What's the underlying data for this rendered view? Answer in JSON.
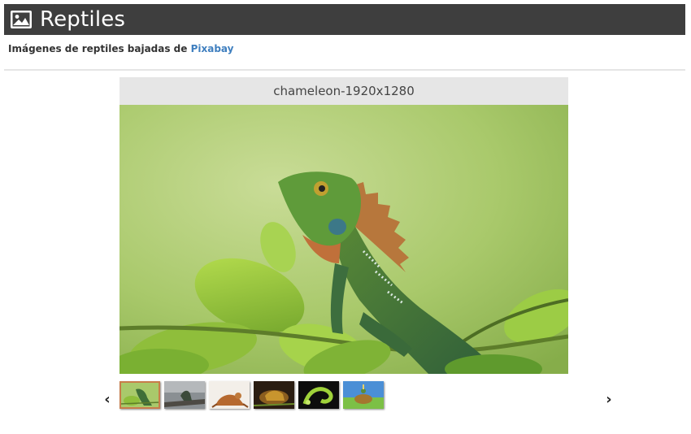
{
  "header": {
    "title": "Reptiles",
    "icon": "image-icon"
  },
  "subtitle": {
    "text": "Imágenes de reptiles bajadas de ",
    "link_label": "Pixabay"
  },
  "viewer": {
    "caption": "chameleon-1920x1280",
    "prev_label": "‹",
    "next_label": "›"
  },
  "thumbnails": [
    {
      "name": "chameleon",
      "active": true
    },
    {
      "name": "lizard-on-branch",
      "active": false
    },
    {
      "name": "gecko",
      "active": false
    },
    {
      "name": "lizard-dark",
      "active": false
    },
    {
      "name": "green-snake",
      "active": false
    },
    {
      "name": "turtle",
      "active": false
    }
  ],
  "colors": {
    "header_bg": "#3e3e3e",
    "link": "#3f7fbf",
    "caption_bg": "#e6e6e6",
    "active_thumb_border": "#c87d4a"
  }
}
